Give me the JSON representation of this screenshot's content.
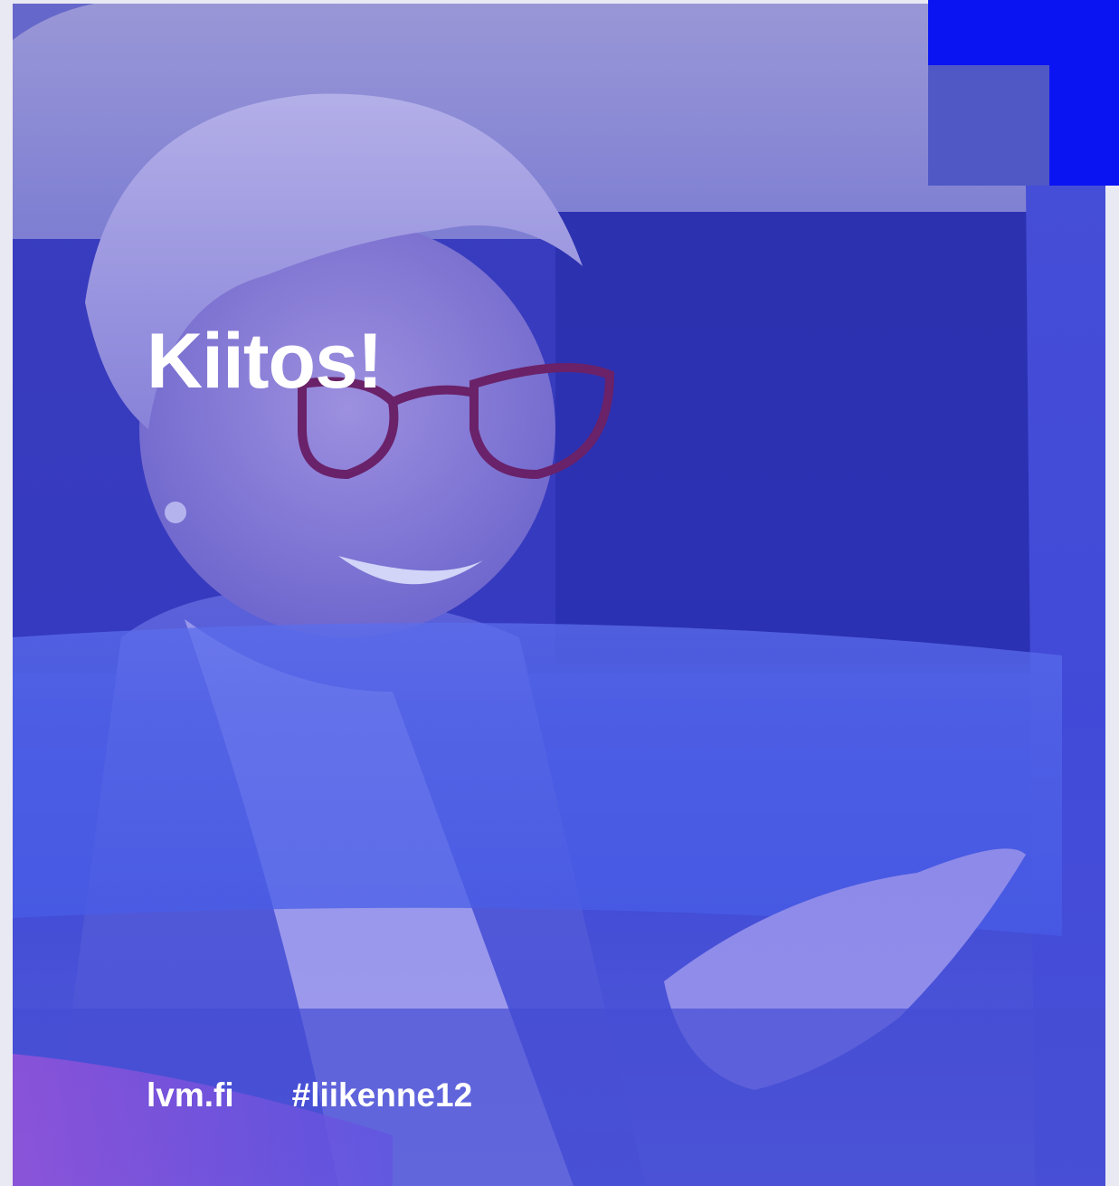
{
  "slide": {
    "title": "Kiitos!",
    "website": "lvm.fi",
    "hashtag": "#liikenne12"
  },
  "colors": {
    "accent": "#0a14f2",
    "tint": "#4a52c6",
    "text": "#ffffff"
  },
  "image": {
    "subject": "smiling woman with short blonde hair and red glasses in a car"
  }
}
